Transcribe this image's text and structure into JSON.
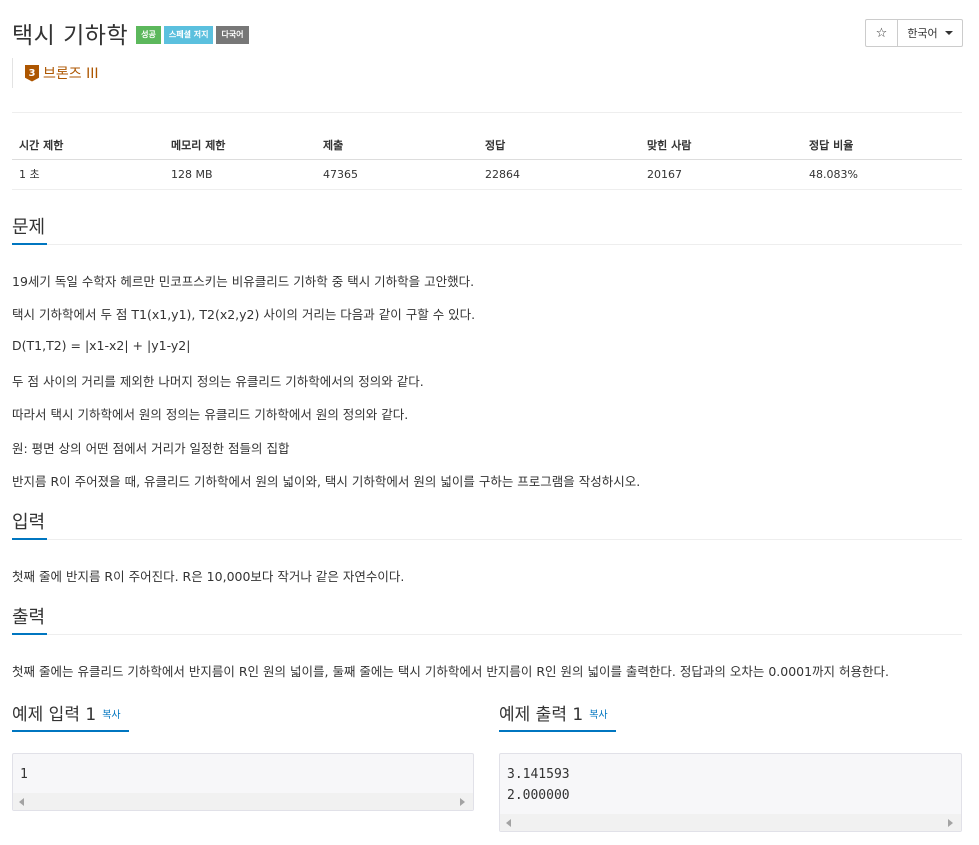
{
  "problem": {
    "title": "택시 기하학",
    "badges": [
      {
        "label": "성공",
        "color": "#5cb85c"
      },
      {
        "label": "스페셜 저지",
        "color": "#5bc0de"
      },
      {
        "label": "다국어",
        "color": "#777777"
      }
    ],
    "tier": {
      "level": "3",
      "name": "브론즈 III",
      "color": "#ad5600"
    }
  },
  "actions": {
    "star_icon": "☆",
    "language": "한국어"
  },
  "info_table": {
    "headers": [
      "시간 제한",
      "메모리 제한",
      "제출",
      "정답",
      "맞힌 사람",
      "정답 비율"
    ],
    "values": [
      "1 초",
      "128 MB",
      "47365",
      "22864",
      "20167",
      "48.083%"
    ]
  },
  "sections": {
    "problem": {
      "heading": "문제",
      "paragraphs": [
        "19세기 독일 수학자 헤르만 민코프스키는 비유클리드 기하학 중 택시 기하학을 고안했다.",
        "택시 기하학에서 두 점 T1(x1,y1), T2(x2,y2) 사이의 거리는 다음과 같이 구할 수 있다.",
        "D(T1,T2) = |x1-x2| + |y1-y2|",
        "두 점 사이의 거리를 제외한 나머지 정의는 유클리드 기하학에서의 정의와 같다.",
        "따라서 택시 기하학에서 원의 정의는 유클리드 기하학에서 원의 정의와 같다.",
        "원: 평면 상의 어떤 점에서 거리가 일정한 점들의 집합",
        "반지름 R이 주어졌을 때, 유클리드 기하학에서 원의 넓이와, 택시 기하학에서 원의 넓이를 구하는 프로그램을 작성하시오."
      ]
    },
    "input": {
      "heading": "입력",
      "text": "첫째 줄에 반지름 R이 주어진다. R은 10,000보다 작거나 같은 자연수이다."
    },
    "output": {
      "heading": "출력",
      "text": "첫째 줄에는 유클리드 기하학에서 반지름이 R인 원의 넓이를, 둘째 줄에는 택시 기하학에서 반지름이 R인 원의 넓이를 출력한다. 정답과의 오차는 0.0001까지 허용한다."
    }
  },
  "samples": {
    "input": {
      "heading": "예제 입력 1",
      "copy": "복사",
      "content": "1"
    },
    "output": {
      "heading": "예제 출력 1",
      "copy": "복사",
      "content": "3.141593\n2.000000"
    }
  }
}
